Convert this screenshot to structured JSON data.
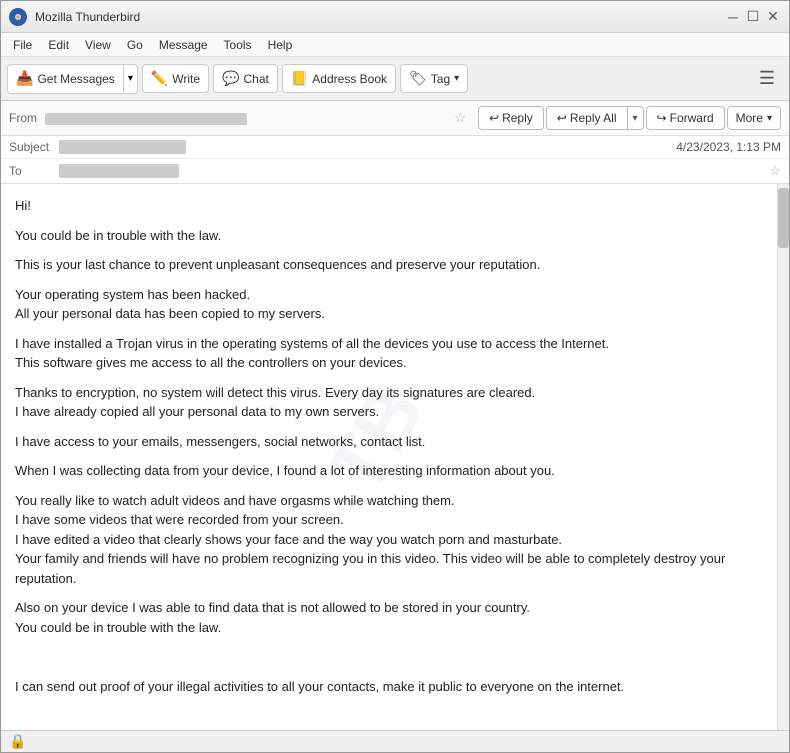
{
  "window": {
    "title": "Mozilla Thunderbird",
    "app_name_label": "Mozilla Thunderbird",
    "app_icon_label": "TB"
  },
  "menu": {
    "items": [
      "File",
      "Edit",
      "View",
      "Go",
      "Message",
      "Tools",
      "Help"
    ]
  },
  "toolbar": {
    "get_messages_label": "Get Messages",
    "write_label": "Write",
    "chat_label": "Chat",
    "address_book_label": "Address Book",
    "tag_label": "Tag",
    "hamburger_label": "☰"
  },
  "email_header": {
    "from_label": "From",
    "from_value_blurred": "████ ████████  ████████████████████",
    "subject_label": "Subject",
    "subject_value_blurred": "████ ███████",
    "date_value": "4/23/2023, 1:13 PM",
    "to_label": "To",
    "to_value_blurred": "████████████████"
  },
  "action_buttons": {
    "reply_label": "Reply",
    "reply_all_label": "Reply All",
    "forward_label": "Forward",
    "more_label": "More"
  },
  "email_body": {
    "paragraphs": [
      "Hi!",
      "You could be in trouble with the law.",
      "This is your last chance to prevent unpleasant consequences and preserve your reputation.",
      "Your operating system has been hacked.\nAll your personal data has been copied to my servers.",
      "I have installed a Trojan virus in the operating systems of all the devices you use to access the Internet.\nThis software gives me access to all the controllers on your devices.",
      "Thanks to encryption, no system will detect this virus. Every day its signatures are cleared.\nI have already copied all your personal data to my own servers.",
      "I have access to your emails, messengers, social networks, contact list.",
      "When I was collecting data from your device, I found a lot of interesting information about you.",
      "You really like to watch adult videos and have orgasms while watching them.\nI have some videos that were recorded from your screen.\nI have edited a video that clearly shows your face and the way you watch porn and masturbate.\nYour family and friends will have no problem recognizing you in this video. This video will be able to completely destroy your reputation.",
      "Also on your device I was able to find data that is not allowed to be stored in your country.\nYou could be in trouble with the law.",
      "I can send out proof of your illegal activities to all your contacts, make it public to everyone on the internet."
    ]
  },
  "status_bar": {
    "icon": "🔒",
    "text": ""
  }
}
